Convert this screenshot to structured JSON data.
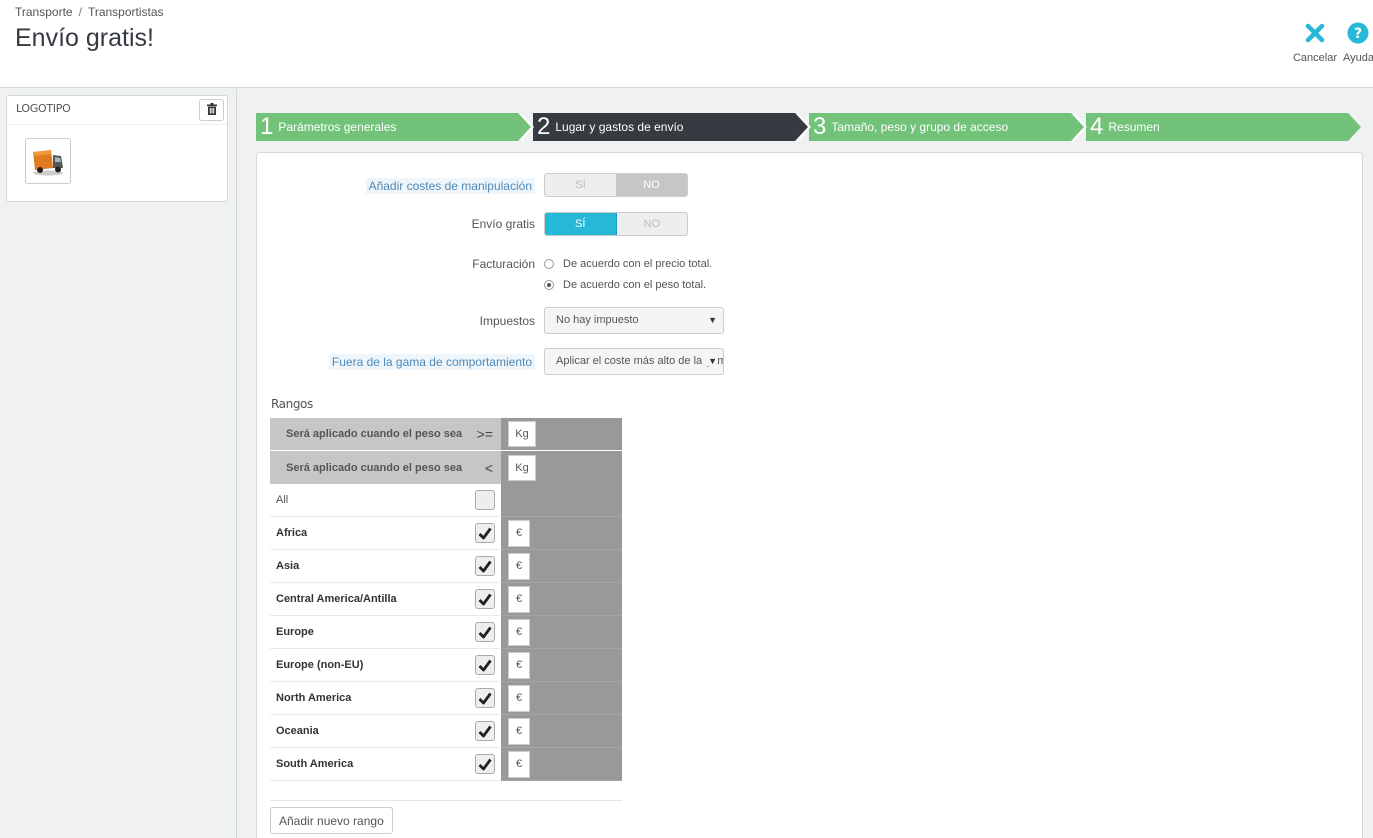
{
  "breadcrumb": {
    "item1": "Transporte",
    "separator": "/",
    "item2": "Transportistas"
  },
  "page_title": "Envío gratis!",
  "toolbar": {
    "cancel": {
      "label": "Cancelar",
      "icon": "close-icon",
      "color": "#25b9d7"
    },
    "help": {
      "label": "Ayuda",
      "icon": "help-icon",
      "color": "#25b9d7"
    }
  },
  "logo_panel": {
    "title": "LOGOTIPO",
    "delete_icon": "trash-icon",
    "image": "truck-logo"
  },
  "steps": [
    {
      "number": "1",
      "label": "Parámetros generales",
      "active": false
    },
    {
      "number": "2",
      "label": "Lugar y gastos de envío",
      "active": true
    },
    {
      "number": "3",
      "label": "Tamaño, peso y grupo de acceso",
      "active": false
    },
    {
      "number": "4",
      "label": "Resumen",
      "active": false
    }
  ],
  "form": {
    "handling": {
      "label": "Añadir costes de manipulación",
      "yes": "SÍ",
      "no": "NO",
      "value": "NO"
    },
    "free_shipping": {
      "label": "Envío gratis",
      "yes": "SÍ",
      "no": "NO",
      "value": "SÍ"
    },
    "billing": {
      "label": "Facturación",
      "options": [
        "De acuerdo con el precio total.",
        "De acuerdo con el peso total."
      ],
      "selected": "De acuerdo con el peso total."
    },
    "taxes": {
      "label": "Impuestos",
      "value": "No hay impuesto"
    },
    "out_of_range": {
      "label": "Fuera de la gama de comportamiento",
      "value": "Aplicar el coste más alto de la gama definida"
    }
  },
  "ranges": {
    "title": "Rangos",
    "from_label": "Será aplicado cuando el peso sea",
    "from_op": ">=",
    "to_label": "Será aplicado cuando el peso sea",
    "to_op": "<",
    "unit": "Kg",
    "currency": "€",
    "all_label": "All",
    "zones": [
      {
        "name": "Africa",
        "checked": true
      },
      {
        "name": "Asia",
        "checked": true
      },
      {
        "name": "Central America/Antilla",
        "checked": true
      },
      {
        "name": "Europe",
        "checked": true
      },
      {
        "name": "Europe (non-EU)",
        "checked": true
      },
      {
        "name": "North America",
        "checked": true
      },
      {
        "name": "Oceania",
        "checked": true
      },
      {
        "name": "South America",
        "checked": true
      }
    ],
    "add_button": "Añadir nuevo rango"
  }
}
